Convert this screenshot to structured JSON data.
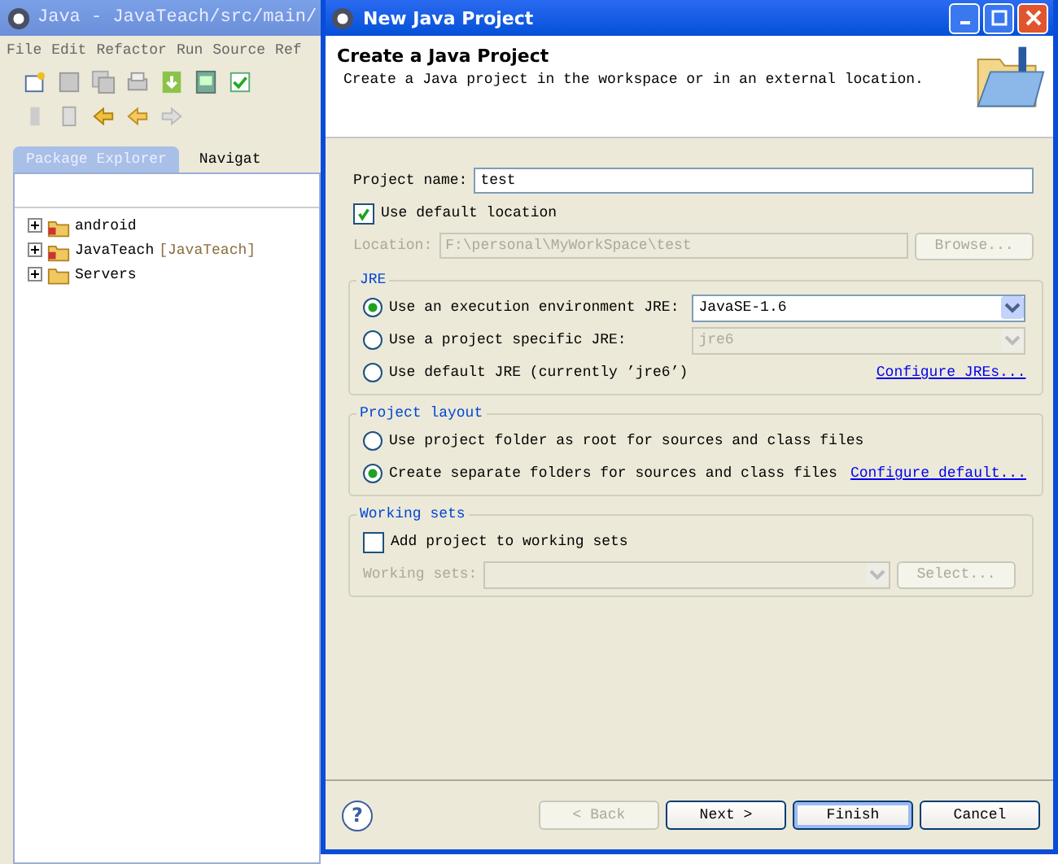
{
  "background_window": {
    "title": "Java - JavaTeach/src/main/",
    "menu": [
      "File",
      "Edit",
      "Refactor",
      "Run",
      "Source",
      "Ref"
    ],
    "views": [
      {
        "label": "Package Explorer",
        "selected": true
      },
      {
        "label": "Navigat",
        "selected": false
      }
    ],
    "tree": [
      {
        "label": "android",
        "kind": "project"
      },
      {
        "label": "JavaTeach",
        "decoration": "[JavaTeach]",
        "kind": "project"
      },
      {
        "label": "Servers",
        "kind": "folder"
      }
    ]
  },
  "dialog": {
    "title": "New Java Project",
    "header": {
      "title": "Create a Java Project",
      "description": "Create a Java project in the workspace or in an external location."
    },
    "project_name": {
      "label": "Project name:",
      "value": "test"
    },
    "use_default_location": {
      "label": "Use default location",
      "checked": true
    },
    "location": {
      "label": "Location:",
      "value": "F:\\personal\\MyWorkSpace\\test",
      "disabled": true,
      "browse": "Browse..."
    },
    "groups": [
      {
        "title": "JRE",
        "options": [
          {
            "label": "Use an execution environment JRE:",
            "selected": true,
            "combo": {
              "value": "JavaSE-1.6",
              "disabled": false
            }
          },
          {
            "label": "Use a project specific JRE:",
            "selected": false,
            "combo": {
              "value": "jre6",
              "disabled": true
            }
          },
          {
            "label": "Use default JRE (currently ’jre6’)",
            "selected": false,
            "link": "Configure JREs..."
          }
        ]
      },
      {
        "title": "Project layout",
        "options": [
          {
            "label": "Use project folder as root for sources and class files",
            "selected": false
          },
          {
            "label": "Create separate folders for sources and class files",
            "selected": true,
            "link": "Configure default..."
          }
        ]
      }
    ],
    "working_sets": {
      "title": "Working sets",
      "checkbox": {
        "label": "Add project to working sets",
        "checked": false
      },
      "field_label": "Working sets:",
      "disabled": true,
      "select": "Select..."
    },
    "help": "?",
    "buttons": [
      {
        "label": "< Back",
        "disabled": true,
        "default": false
      },
      {
        "label": "Next >",
        "disabled": false,
        "default": false
      },
      {
        "label": "Finish",
        "disabled": false,
        "default": true
      },
      {
        "label": "Cancel",
        "disabled": false,
        "default": false
      }
    ]
  }
}
